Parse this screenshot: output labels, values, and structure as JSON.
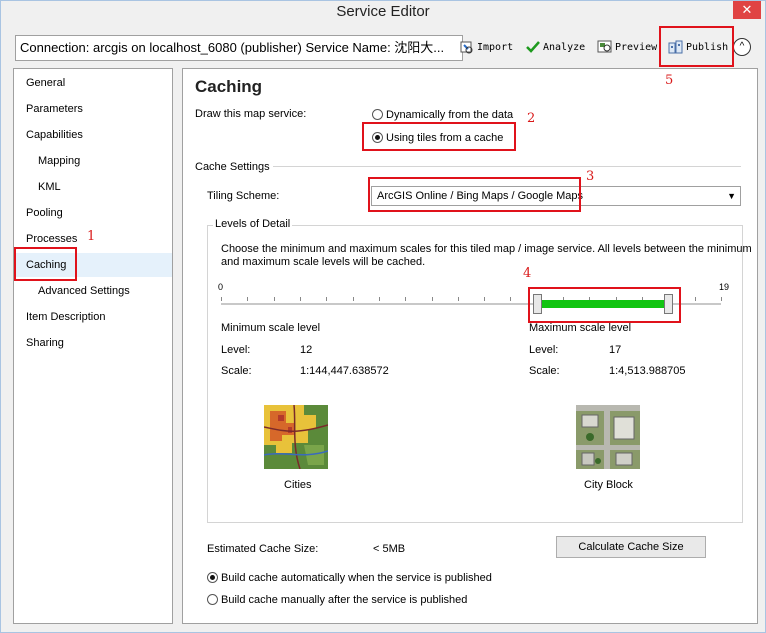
{
  "window": {
    "title": "Service Editor",
    "close_label": "✕"
  },
  "toolbar": {
    "connection_text": "Connection: arcgis on localhost_6080 (publisher)    Service Name: 沈阳大...",
    "import_label": "Import",
    "analyze_label": "Analyze",
    "preview_label": "Preview",
    "publish_label": "Publish",
    "collapse_label": "^"
  },
  "sidebar": {
    "items": [
      {
        "label": "General"
      },
      {
        "label": "Parameters"
      },
      {
        "label": "Capabilities"
      },
      {
        "label": "Mapping"
      },
      {
        "label": "KML"
      },
      {
        "label": "Pooling"
      },
      {
        "label": "Processes"
      },
      {
        "label": "Caching"
      },
      {
        "label": "Advanced Settings"
      },
      {
        "label": "Item Description"
      },
      {
        "label": "Sharing"
      }
    ]
  },
  "caching": {
    "title": "Caching",
    "draw_label": "Draw this map service:",
    "option_dynamic": "Dynamically from the data",
    "option_tiles": "Using tiles from a cache",
    "cache_settings_label": "Cache Settings",
    "tiling_scheme_label": "Tiling Scheme:",
    "tiling_scheme_value": "ArcGIS Online / Bing Maps / Google Maps",
    "lod_label": "Levels of Detail",
    "lod_desc_line1": "Choose the minimum and maximum scales for this tiled map / image service. All levels between the minimum",
    "lod_desc_line2": "and maximum scale levels will be cached.",
    "slider_min_label": "0",
    "slider_max_label": "19",
    "slider": {
      "min": 0,
      "max": 19,
      "low": 12,
      "high": 17
    },
    "min_scale_label": "Minimum scale level",
    "max_scale_label": "Maximum scale level",
    "level_label": "Level:",
    "scale_label": "Scale:",
    "min_level_value": "12",
    "max_level_value": "17",
    "min_scale_value": "1:144,447.638572",
    "max_scale_value": "1:4,513.988705",
    "min_thumb_caption": "Cities",
    "max_thumb_caption": "City Block",
    "estimated_size_label": "Estimated Cache Size:",
    "estimated_size_value": "< 5MB",
    "calc_button_label": "Calculate Cache Size",
    "build_auto_label": "Build cache automatically when the service is published",
    "build_manual_label": "Build cache manually after the service is published"
  },
  "annotations": {
    "n1": "1",
    "n2": "2",
    "n3": "3",
    "n4": "4",
    "n5": "5"
  },
  "colors": {
    "annotation_red": "#e0121b",
    "range_green": "#11c411",
    "selected_bg": "#e5f1fb"
  }
}
